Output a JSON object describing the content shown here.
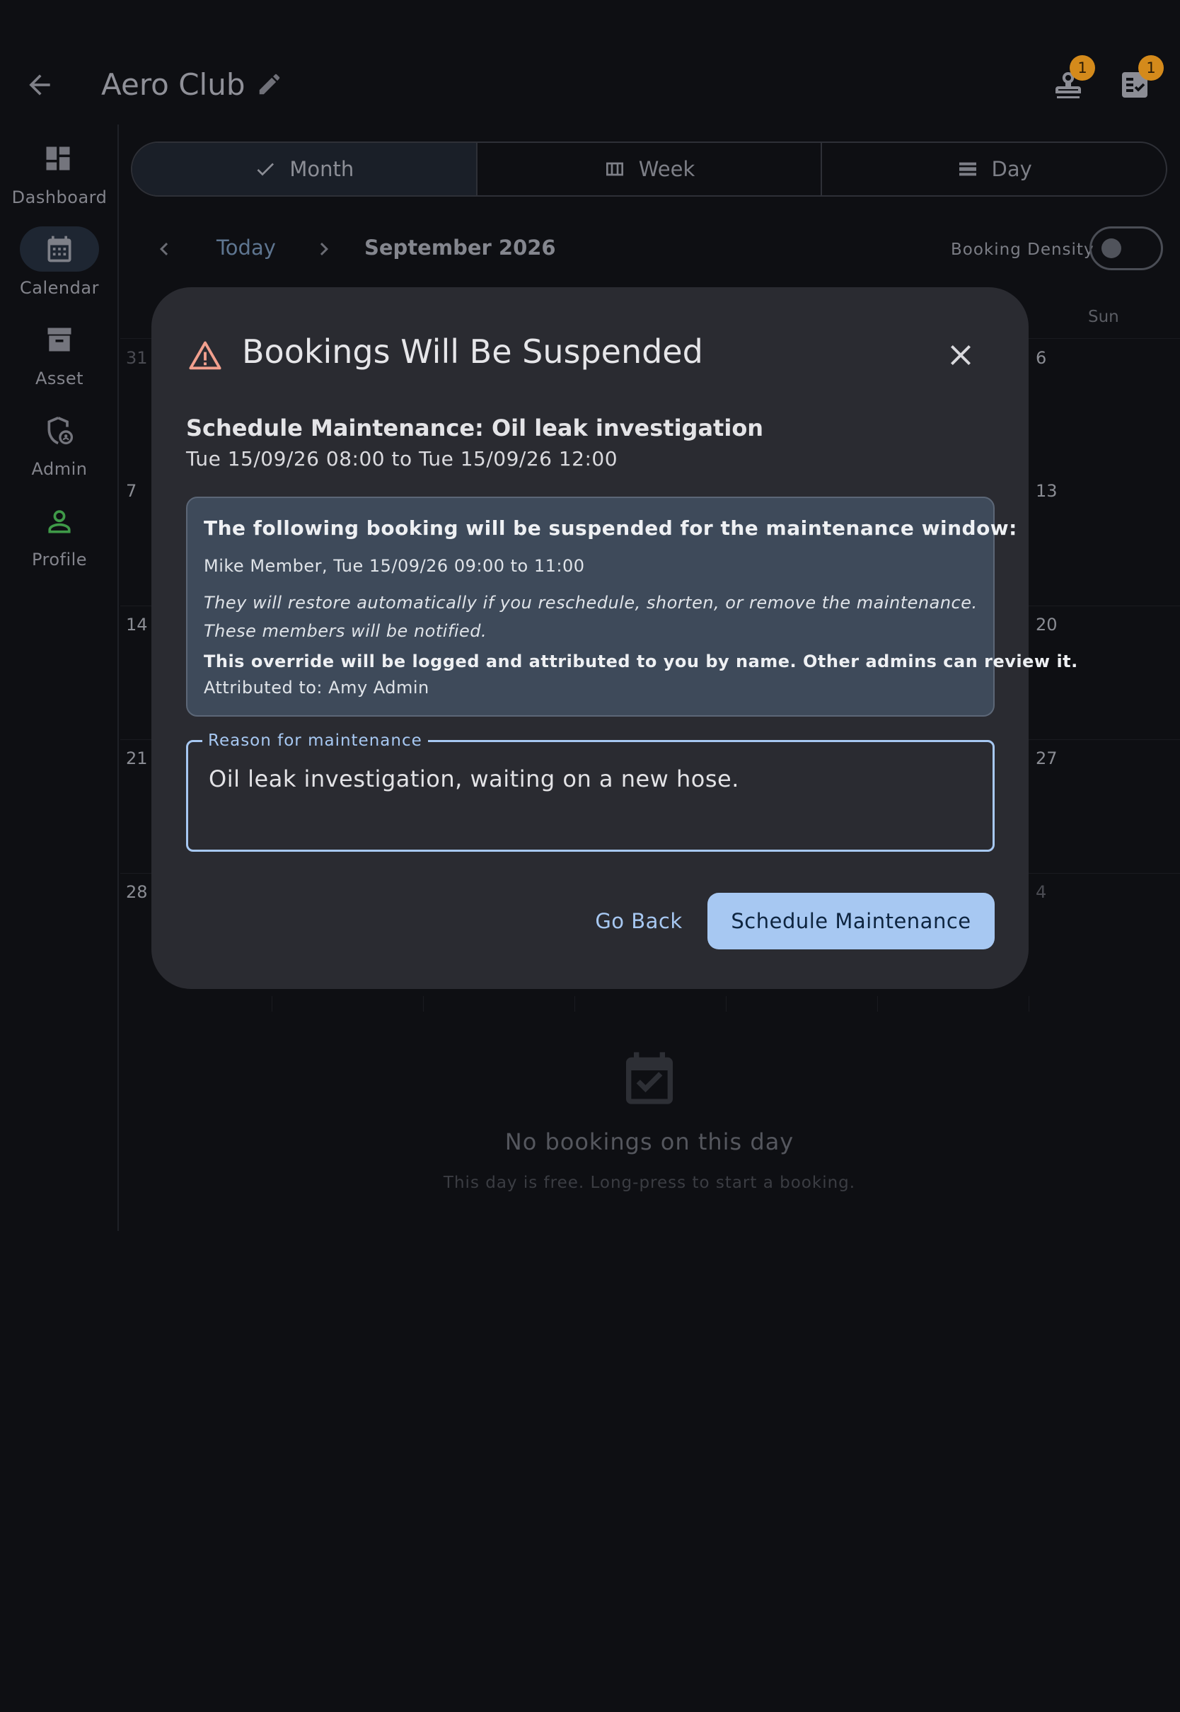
{
  "appbar": {
    "title": "Aero Club",
    "badge_left": "1",
    "badge_right": "1"
  },
  "nav": {
    "items": [
      {
        "label": "Dashboard"
      },
      {
        "label": "Calendar"
      },
      {
        "label": "Asset"
      },
      {
        "label": "Admin"
      },
      {
        "label": "Profile"
      }
    ]
  },
  "view_switcher": {
    "month": "Month",
    "week": "Week",
    "day": "Day"
  },
  "calendar": {
    "today_label": "Today",
    "month_title": "September 2026",
    "density_label": "Booking Density",
    "weekday_sun": "Sun",
    "week_starts": [
      "31",
      "7",
      "14",
      "21",
      "28"
    ],
    "week_ends": [
      "6",
      "13",
      "20",
      "27",
      "4"
    ]
  },
  "empty_state": {
    "title": "No bookings on this day",
    "subtitle": "This day is free. Long-press to start a booking."
  },
  "dialog": {
    "title": "Bookings Will Be Suspended",
    "subtitle": "Schedule Maintenance: Oil leak investigation",
    "time_range": "Tue 15/09/26 08:00 to Tue 15/09/26 12:00",
    "alert": {
      "heading": "The following booking will be suspended for the maintenance window:",
      "booking": "Mike Member, Tue 15/09/26 09:00 to 11:00",
      "restore_note_1": "They will restore automatically if you reschedule, shorten, or remove the maintenance.",
      "restore_note_2": "These members will be notified.",
      "override_note": "This override will be logged and attributed to you by name. Other admins can review it.",
      "attributed": "Attributed to: Amy Admin"
    },
    "reason_label": "Reason for maintenance",
    "reason_value": "Oil leak investigation, waiting on a new hose.",
    "go_back": "Go Back",
    "confirm": "Schedule Maintenance"
  },
  "colors": {
    "primary": "#a7c8f2",
    "warning": "#f2a08e",
    "badge": "#d48a1b",
    "profile_accent": "#3f9a48"
  }
}
